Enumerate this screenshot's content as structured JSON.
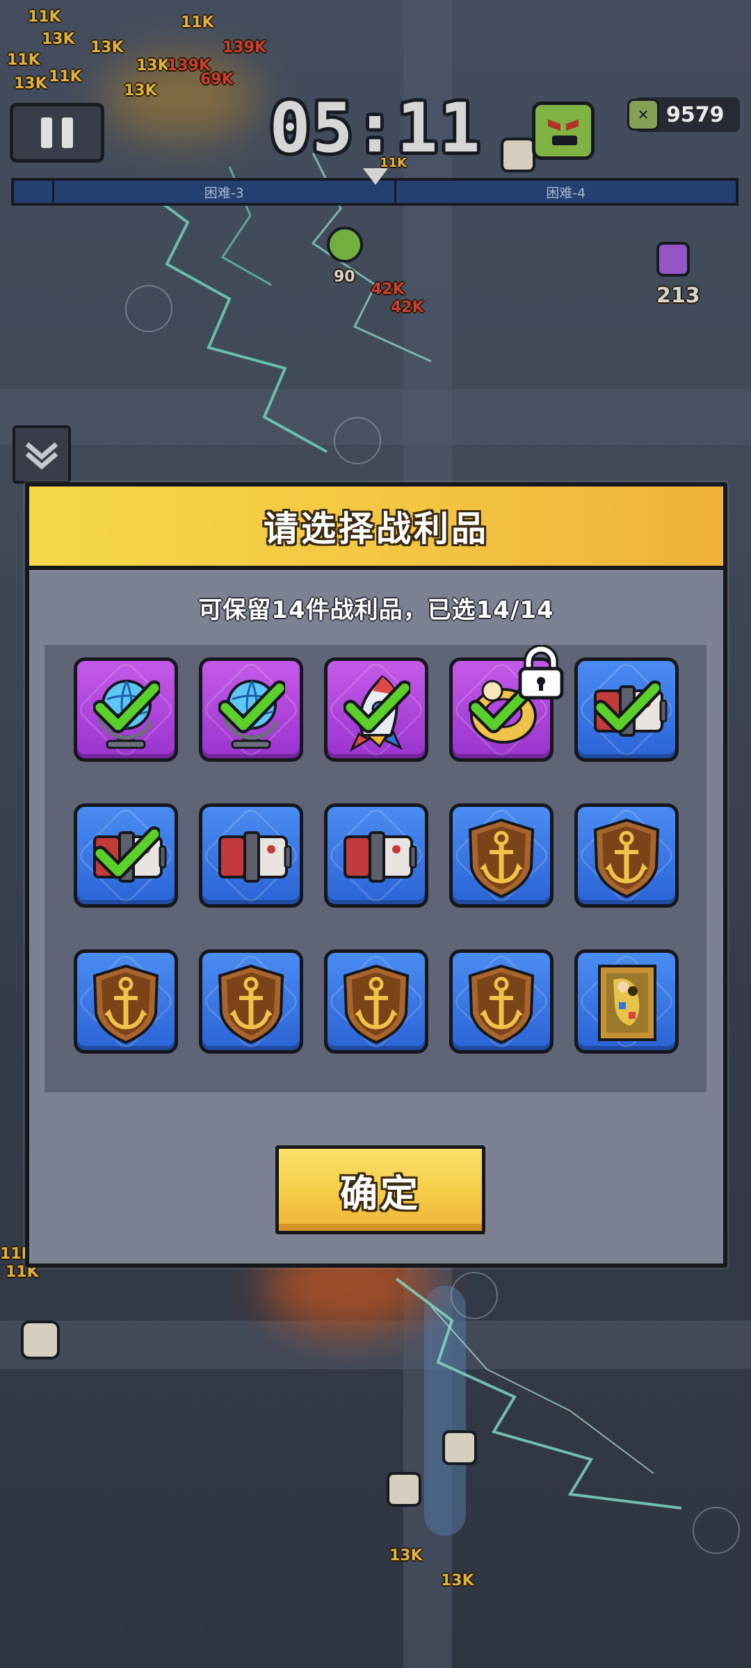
{
  "hud": {
    "timer": "05:11",
    "kill_count": "9579",
    "stage_left": "困难-3",
    "stage_right": "困难-4"
  },
  "scene": {
    "damage_numbers": [
      "11K",
      "13K",
      "13K",
      "11K",
      "11K",
      "13K",
      "11K",
      "13K",
      "13K",
      "139K",
      "139K",
      "69K",
      "11K",
      "42K",
      "42K",
      "90",
      "213",
      "13K",
      "13K",
      "11K",
      "11K"
    ]
  },
  "dialog": {
    "title": "请选择战利品",
    "subtitle": "可保留14件战利品，已选14/14",
    "confirm_label": "确定",
    "items": [
      {
        "icon": "globe-icon",
        "rarity": "purple",
        "selected": true,
        "locked": false
      },
      {
        "icon": "globe-icon",
        "rarity": "purple",
        "selected": true,
        "locked": false
      },
      {
        "icon": "rocket-icon",
        "rarity": "purple",
        "selected": true,
        "locked": false
      },
      {
        "icon": "ring-icon",
        "rarity": "purple",
        "selected": true,
        "locked": true
      },
      {
        "icon": "battery-icon",
        "rarity": "blue",
        "selected": true,
        "locked": false
      },
      {
        "icon": "battery-icon",
        "rarity": "blue",
        "selected": true,
        "locked": false
      },
      {
        "icon": "battery-icon",
        "rarity": "blue",
        "selected": false,
        "locked": false
      },
      {
        "icon": "battery-icon",
        "rarity": "blue",
        "selected": false,
        "locked": false
      },
      {
        "icon": "anchor-shield-icon",
        "rarity": "blue",
        "selected": false,
        "locked": false
      },
      {
        "icon": "anchor-shield-icon",
        "rarity": "blue",
        "selected": false,
        "locked": false
      },
      {
        "icon": "anchor-shield-icon",
        "rarity": "blue",
        "selected": false,
        "locked": false
      },
      {
        "icon": "anchor-shield-icon",
        "rarity": "blue",
        "selected": false,
        "locked": false
      },
      {
        "icon": "anchor-shield-icon",
        "rarity": "blue",
        "selected": false,
        "locked": false
      },
      {
        "icon": "anchor-shield-icon",
        "rarity": "blue",
        "selected": false,
        "locked": false
      },
      {
        "icon": "painting-icon",
        "rarity": "blue",
        "selected": false,
        "locked": false
      }
    ]
  },
  "colors": {
    "purple_tile": "#b046df",
    "blue_tile": "#3a78e8",
    "header_yellow": "#f3c541",
    "check_green": "#5bd02a"
  }
}
